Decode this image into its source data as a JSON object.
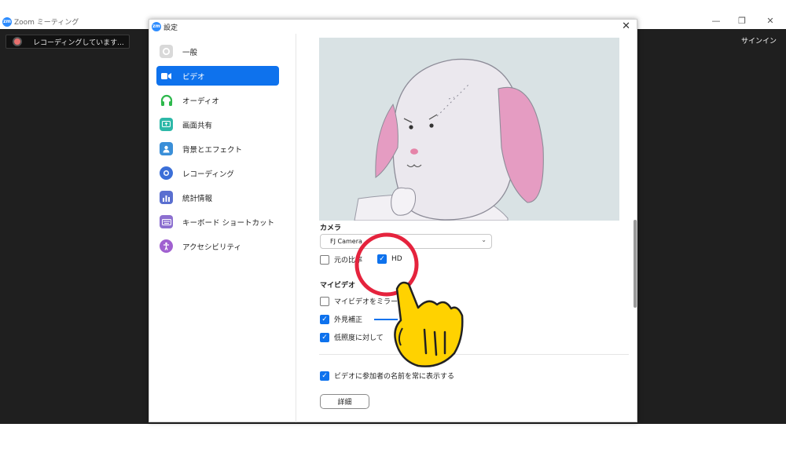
{
  "meeting": {
    "logo_text": "zm",
    "title": "Zoom ミーティング",
    "recording_status": "レコーディングしています...",
    "signin_label": "サインイン",
    "minimize_glyph": "—",
    "restore_glyph": "❐",
    "close_glyph": "✕"
  },
  "settings": {
    "logo_text": "zm",
    "title": "設定",
    "close_glyph": "✕",
    "nav": [
      {
        "label": "一般",
        "icon": "gear-icon",
        "color": "#d9d9d9"
      },
      {
        "label": "ビデオ",
        "icon": "video-camera-icon",
        "color": "#0e72ed"
      },
      {
        "label": "オーディオ",
        "icon": "headphones-icon",
        "color": "#2db84c"
      },
      {
        "label": "画面共有",
        "icon": "screen-share-icon",
        "color": "#2db8a8"
      },
      {
        "label": "背景とエフェクト",
        "icon": "person-background-icon",
        "color": "#3a8fd8"
      },
      {
        "label": "レコーディング",
        "icon": "record-icon",
        "color": "#3b6fd8"
      },
      {
        "label": "統計情報",
        "icon": "statistics-icon",
        "color": "#5a6fd0"
      },
      {
        "label": "キーボード ショートカット",
        "icon": "keyboard-icon",
        "color": "#8c6fd0"
      },
      {
        "label": "アクセシビリティ",
        "icon": "accessibility-icon",
        "color": "#a060d0"
      }
    ],
    "active_nav_index": 1,
    "video": {
      "camera_label": "カメラ",
      "camera_value": "FJ Camera",
      "original_ratio_label": "元の比率",
      "original_ratio_checked": false,
      "hd_label": "HD",
      "hd_checked": true,
      "my_video_label": "マイビデオ",
      "mirror_label": "マイビデオをミラー",
      "mirror_checked": false,
      "appearance_label": "外見補正",
      "appearance_checked": true,
      "low_light_label": "低照度に対して",
      "low_light_checked": true,
      "show_names_label": "ビデオに参加者の名前を常に表示する",
      "show_names_checked": true,
      "advanced_button": "詳細"
    }
  },
  "colors": {
    "accent": "#0e72ed",
    "annotation_circle": "#e5233d",
    "annotation_hand": "#ffd200"
  }
}
